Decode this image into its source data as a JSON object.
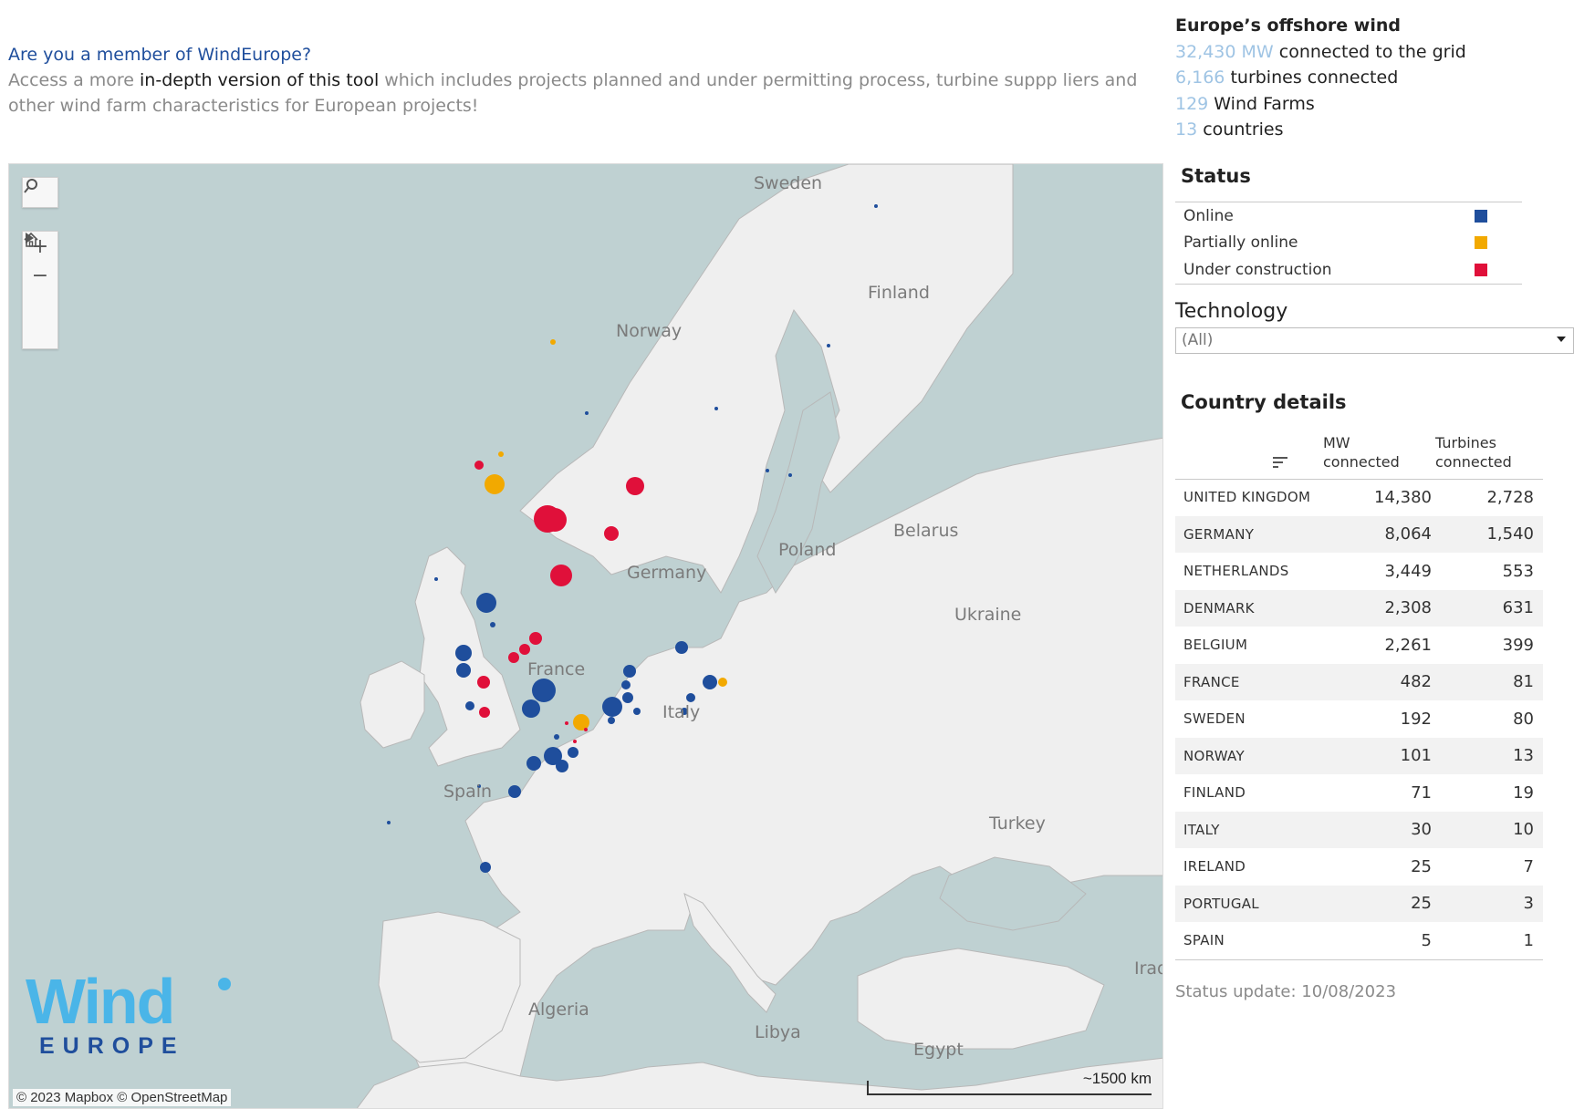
{
  "promo": {
    "question": "Are you a member of WindEurope?",
    "text_before": "Access a more ",
    "link_text": "in-depth version of this tool",
    "text_after": " which includes projects planned and under permitting process,  turbine suppp liers and other wind farm characteristics for European projects!"
  },
  "stats": {
    "title": "Europe’s offshore wind",
    "mw_value": "32,430 MW",
    "mw_label": " connected to the grid",
    "turbines_value": "6,166",
    "turbines_label": " turbines connected",
    "farms_value": "129",
    "farms_label": " Wind Farms",
    "countries_value": "13",
    "countries_label": " countries"
  },
  "legend": {
    "title": "Status",
    "items": [
      {
        "label": "Online",
        "color": "#1f4e9c"
      },
      {
        "label": "Partially online",
        "color": "#f2a900"
      },
      {
        "label": "Under construction",
        "color": "#e0103a"
      }
    ]
  },
  "technology": {
    "label": "Technology",
    "selected": "(All)"
  },
  "country_details": {
    "title": "Country details",
    "col_mw": "MW connected",
    "col_turbines": "Turbines connected",
    "rows": [
      {
        "country": "UNITED KINGDOM",
        "mw": "14,380",
        "turbines": "2,728"
      },
      {
        "country": "GERMANY",
        "mw": "8,064",
        "turbines": "1,540"
      },
      {
        "country": "NETHERLANDS",
        "mw": "3,449",
        "turbines": "553"
      },
      {
        "country": "DENMARK",
        "mw": "2,308",
        "turbines": "631"
      },
      {
        "country": "BELGIUM",
        "mw": "2,261",
        "turbines": "399"
      },
      {
        "country": "FRANCE",
        "mw": "482",
        "turbines": "81"
      },
      {
        "country": "SWEDEN",
        "mw": "192",
        "turbines": "80"
      },
      {
        "country": "NORWAY",
        "mw": "101",
        "turbines": "13"
      },
      {
        "country": "FINLAND",
        "mw": "71",
        "turbines": "19"
      },
      {
        "country": "ITALY",
        "mw": "30",
        "turbines": "10"
      },
      {
        "country": "IRELAND",
        "mw": "25",
        "turbines": "7"
      },
      {
        "country": "PORTUGAL",
        "mw": "25",
        "turbines": "3"
      },
      {
        "country": "SPAIN",
        "mw": "5",
        "turbines": "1"
      }
    ]
  },
  "status_update": "Status update: 10/08/2023",
  "map": {
    "labels": [
      "Sweden",
      "Finland",
      "Norway",
      "Belarus",
      "Poland",
      "Germany",
      "Ukraine",
      "France",
      "Italy",
      "Spain",
      "Turkey",
      "Algeria",
      "Libya",
      "Egypt",
      "Iraq"
    ],
    "attribution": "© 2023 Mapbox  © OpenStreetMap",
    "scale_label": "~1500 km",
    "logo_word": "Wind",
    "logo_sub": "EUROPE"
  }
}
